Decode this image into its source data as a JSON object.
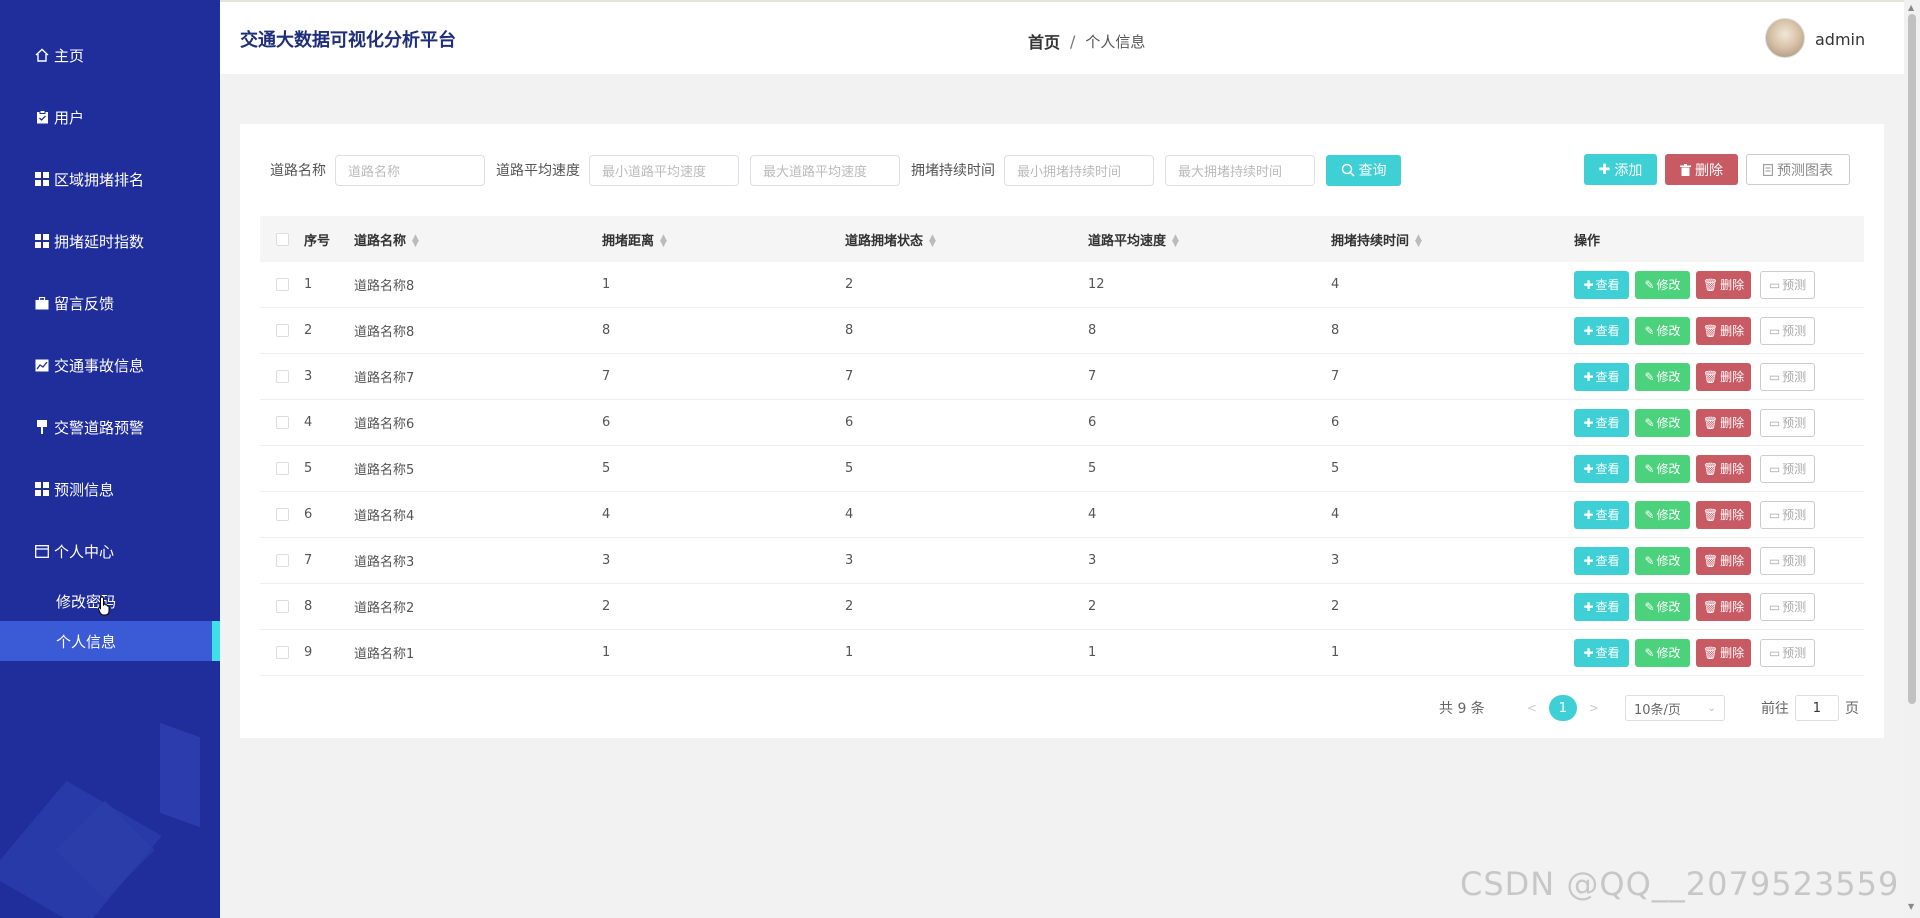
{
  "app_title": "交通大数据可视化分析平台",
  "breadcrumb": {
    "home": "首页",
    "sep": "/",
    "current": "个人信息"
  },
  "user": {
    "name": "admin"
  },
  "sidebar": {
    "items": [
      {
        "label": "主页",
        "icon": "home-icon"
      },
      {
        "label": "用户",
        "icon": "clipboard-icon"
      },
      {
        "label": "区域拥堵排名",
        "icon": "grid-icon"
      },
      {
        "label": "拥堵延时指数",
        "icon": "grid-icon"
      },
      {
        "label": "留言反馈",
        "icon": "briefcase-icon"
      },
      {
        "label": "交通事故信息",
        "icon": "chart-icon"
      },
      {
        "label": "交警道路预警",
        "icon": "marker-icon"
      },
      {
        "label": "预测信息",
        "icon": "grid-icon"
      },
      {
        "label": "个人中心",
        "icon": "window-icon"
      }
    ],
    "sub_items": [
      {
        "label": "修改密码"
      },
      {
        "label": "个人信息",
        "active": true
      }
    ]
  },
  "search": {
    "road_name_label": "道路名称",
    "road_name_placeholder": "道路名称",
    "avg_speed_label": "道路平均速度",
    "min_speed_placeholder": "最小道路平均速度",
    "max_speed_placeholder": "最大道路平均速度",
    "duration_label": "拥堵持续时间",
    "min_duration_placeholder": "最小拥堵持续时间",
    "max_duration_placeholder": "最大拥堵持续时间",
    "query_button": "查询"
  },
  "toolbar": {
    "add": "添加",
    "delete": "删除",
    "predict_chart": "预测图表"
  },
  "table": {
    "headers": {
      "idx": "序号",
      "name": "道路名称",
      "dist": "拥堵距离",
      "state": "道路拥堵状态",
      "speed": "道路平均速度",
      "time": "拥堵持续时间",
      "ops": "操作"
    },
    "op_labels": {
      "view": "查看",
      "edit": "修改",
      "delete": "删除",
      "predict": "预测"
    },
    "rows": [
      {
        "idx": "1",
        "name": "道路名称8",
        "dist": "1",
        "state": "2",
        "speed": "12",
        "time": "4"
      },
      {
        "idx": "2",
        "name": "道路名称8",
        "dist": "8",
        "state": "8",
        "speed": "8",
        "time": "8"
      },
      {
        "idx": "3",
        "name": "道路名称7",
        "dist": "7",
        "state": "7",
        "speed": "7",
        "time": "7"
      },
      {
        "idx": "4",
        "name": "道路名称6",
        "dist": "6",
        "state": "6",
        "speed": "6",
        "time": "6"
      },
      {
        "idx": "5",
        "name": "道路名称5",
        "dist": "5",
        "state": "5",
        "speed": "5",
        "time": "5"
      },
      {
        "idx": "6",
        "name": "道路名称4",
        "dist": "4",
        "state": "4",
        "speed": "4",
        "time": "4"
      },
      {
        "idx": "7",
        "name": "道路名称3",
        "dist": "3",
        "state": "3",
        "speed": "3",
        "time": "3"
      },
      {
        "idx": "8",
        "name": "道路名称2",
        "dist": "2",
        "state": "2",
        "speed": "2",
        "time": "2"
      },
      {
        "idx": "9",
        "name": "道路名称1",
        "dist": "1",
        "state": "1",
        "speed": "1",
        "time": "1"
      }
    ]
  },
  "pagination": {
    "total": "共 9 条",
    "current_page": "1",
    "page_size": "10条/页",
    "goto_label": "前往",
    "goto_value": "1",
    "page_unit": "页"
  },
  "watermark": "CSDN @QQ__2079523559",
  "colors": {
    "sidebar": "#1f2e9b",
    "accent": "#3ed0d5",
    "danger": "#c85a64",
    "success": "#4cd17c"
  }
}
